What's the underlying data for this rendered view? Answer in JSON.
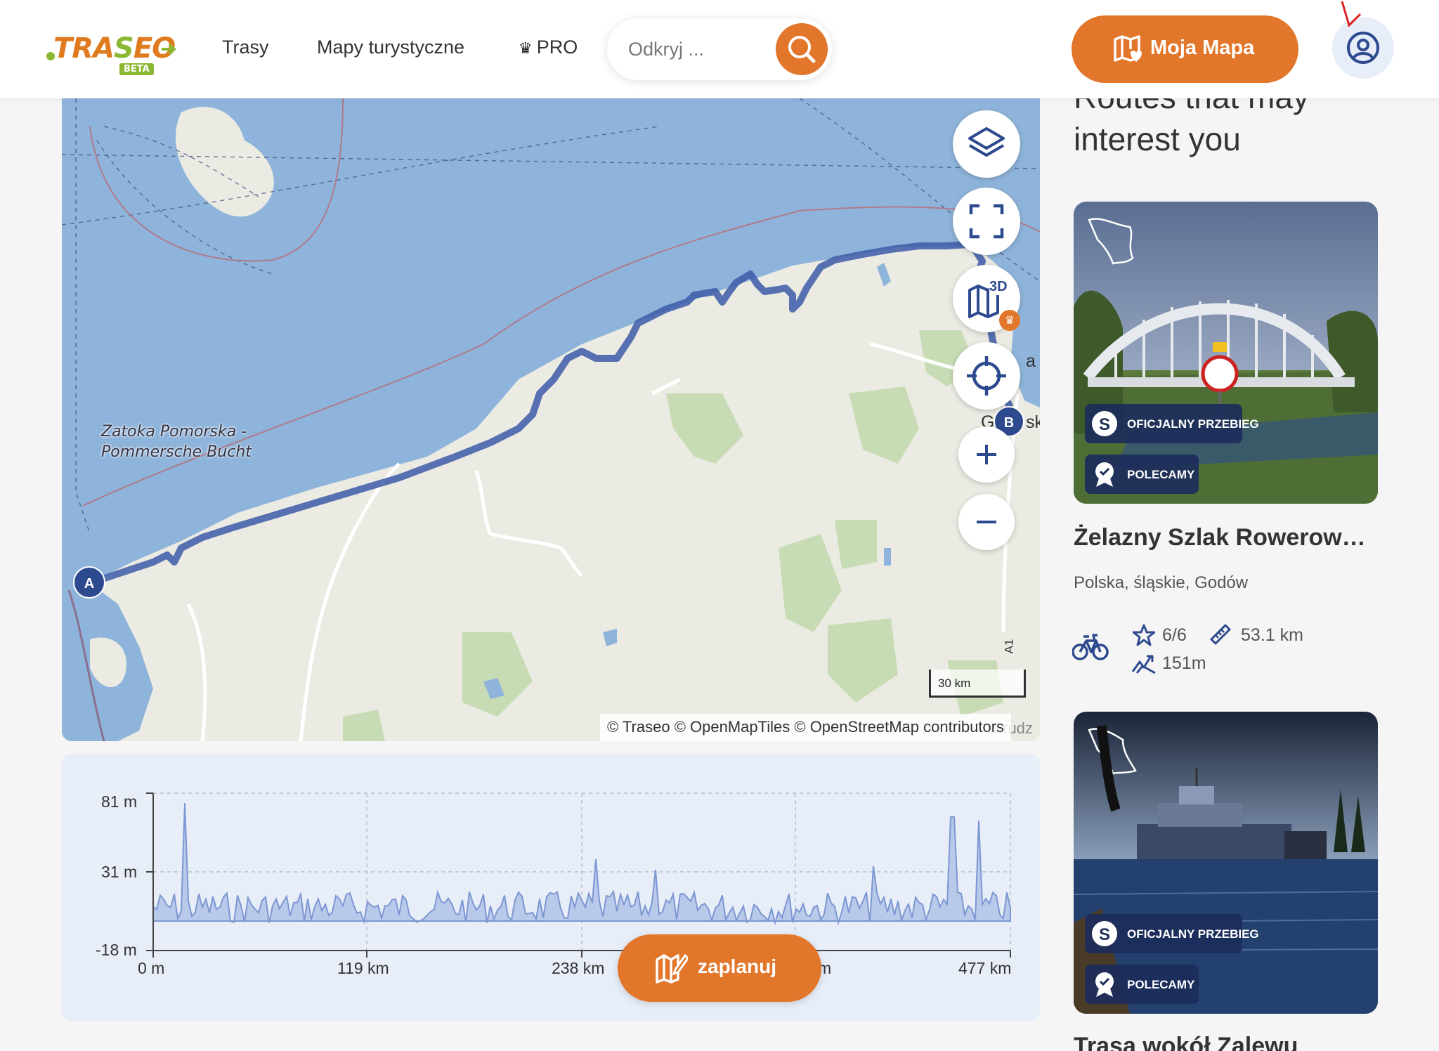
{
  "header": {
    "logo_text_1": "TRA",
    "logo_text_2": "S",
    "logo_text_3": "EO",
    "logo_beta": "BETA",
    "nav": [
      "Trasy",
      "Mapy turystyczne",
      "PRO"
    ],
    "search_placeholder": "Odkryj ...",
    "my_map_label": "Moja Mapa"
  },
  "map": {
    "sea_label_line1": "Zatoka Pomorska -",
    "sea_label_line2": "Pommersche Bucht",
    "start_marker": "A",
    "end_marker": "B",
    "town_partial": "G",
    "town_partial_2": "sk",
    "road_label": "A1",
    "edge_label": "Grudz",
    "edge_label_2": "a",
    "scale_label": "30 km",
    "attribution": "© Traseo © OpenMapTiles © OpenStreetMap contributors",
    "controls": [
      "layers",
      "fullscreen",
      "3D",
      "locate",
      "zoom-in",
      "zoom-out"
    ],
    "three_d_label": "3D"
  },
  "elevation": {
    "y_labels": [
      "81 m",
      "31 m",
      "-18 m"
    ],
    "x_labels": [
      "0 m",
      "119 km",
      "238 km",
      "477 km"
    ],
    "x_partial": "m",
    "plan_label": "zaplanuj"
  },
  "sidebar": {
    "title": "Routes that may interest you",
    "cards": [
      {
        "badge_official": "OFICJALNY PRZEBIEG",
        "badge_recommend": "POLECAMY",
        "title": "Żelazny Szlak Rowerowy ...",
        "location": "Polska, śląskie, Godów",
        "rating": "6/6",
        "distance": "53.1 km",
        "ascent": "151m"
      },
      {
        "badge_official": "OFICJALNY PRZEBIEG",
        "badge_recommend": "POLECAMY",
        "title": "Trasa wokół Zalewu"
      }
    ]
  },
  "colors": {
    "accent": "#e2762a",
    "navy": "#2d4a8f",
    "sea": "#8fb4db",
    "land": "#ebebe3",
    "forest": "#c7dcb4",
    "route": "#3c5ba8"
  }
}
